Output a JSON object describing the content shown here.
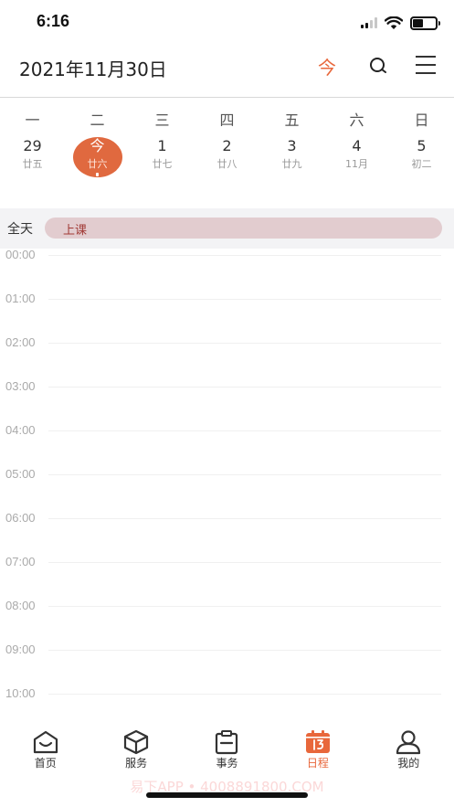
{
  "status_bar": {
    "time": "6:16"
  },
  "header": {
    "date_title": "2021年11月30日",
    "today_label": "今",
    "accent_color": "#e8673b"
  },
  "week": {
    "labels": [
      "一",
      "二",
      "三",
      "四",
      "五",
      "六",
      "日"
    ],
    "days": [
      {
        "num": "29",
        "lunar": "廿五",
        "selected": false
      },
      {
        "num": "今",
        "lunar": "廿六",
        "selected": true
      },
      {
        "num": "1",
        "lunar": "廿七",
        "selected": false
      },
      {
        "num": "2",
        "lunar": "廿八",
        "selected": false
      },
      {
        "num": "3",
        "lunar": "廿九",
        "selected": false
      },
      {
        "num": "4",
        "lunar": "11月",
        "selected": false
      },
      {
        "num": "5",
        "lunar": "初二",
        "selected": false
      }
    ]
  },
  "all_day": {
    "label": "全天",
    "event": "上课"
  },
  "timeline": {
    "hours": [
      "00:00",
      "01:00",
      "02:00",
      "03:00",
      "04:00",
      "05:00",
      "06:00",
      "07:00",
      "08:00",
      "09:00",
      "10:00"
    ]
  },
  "tabs": [
    {
      "label": "首页",
      "icon": "home-icon",
      "active": false
    },
    {
      "label": "服务",
      "icon": "cube-icon",
      "active": false
    },
    {
      "label": "事务",
      "icon": "clipboard-icon",
      "active": false
    },
    {
      "label": "日程",
      "icon": "calendar-icon",
      "active": true
    },
    {
      "label": "我的",
      "icon": "person-icon",
      "active": false
    }
  ],
  "watermark": "易下APP • 4008891800.COM"
}
